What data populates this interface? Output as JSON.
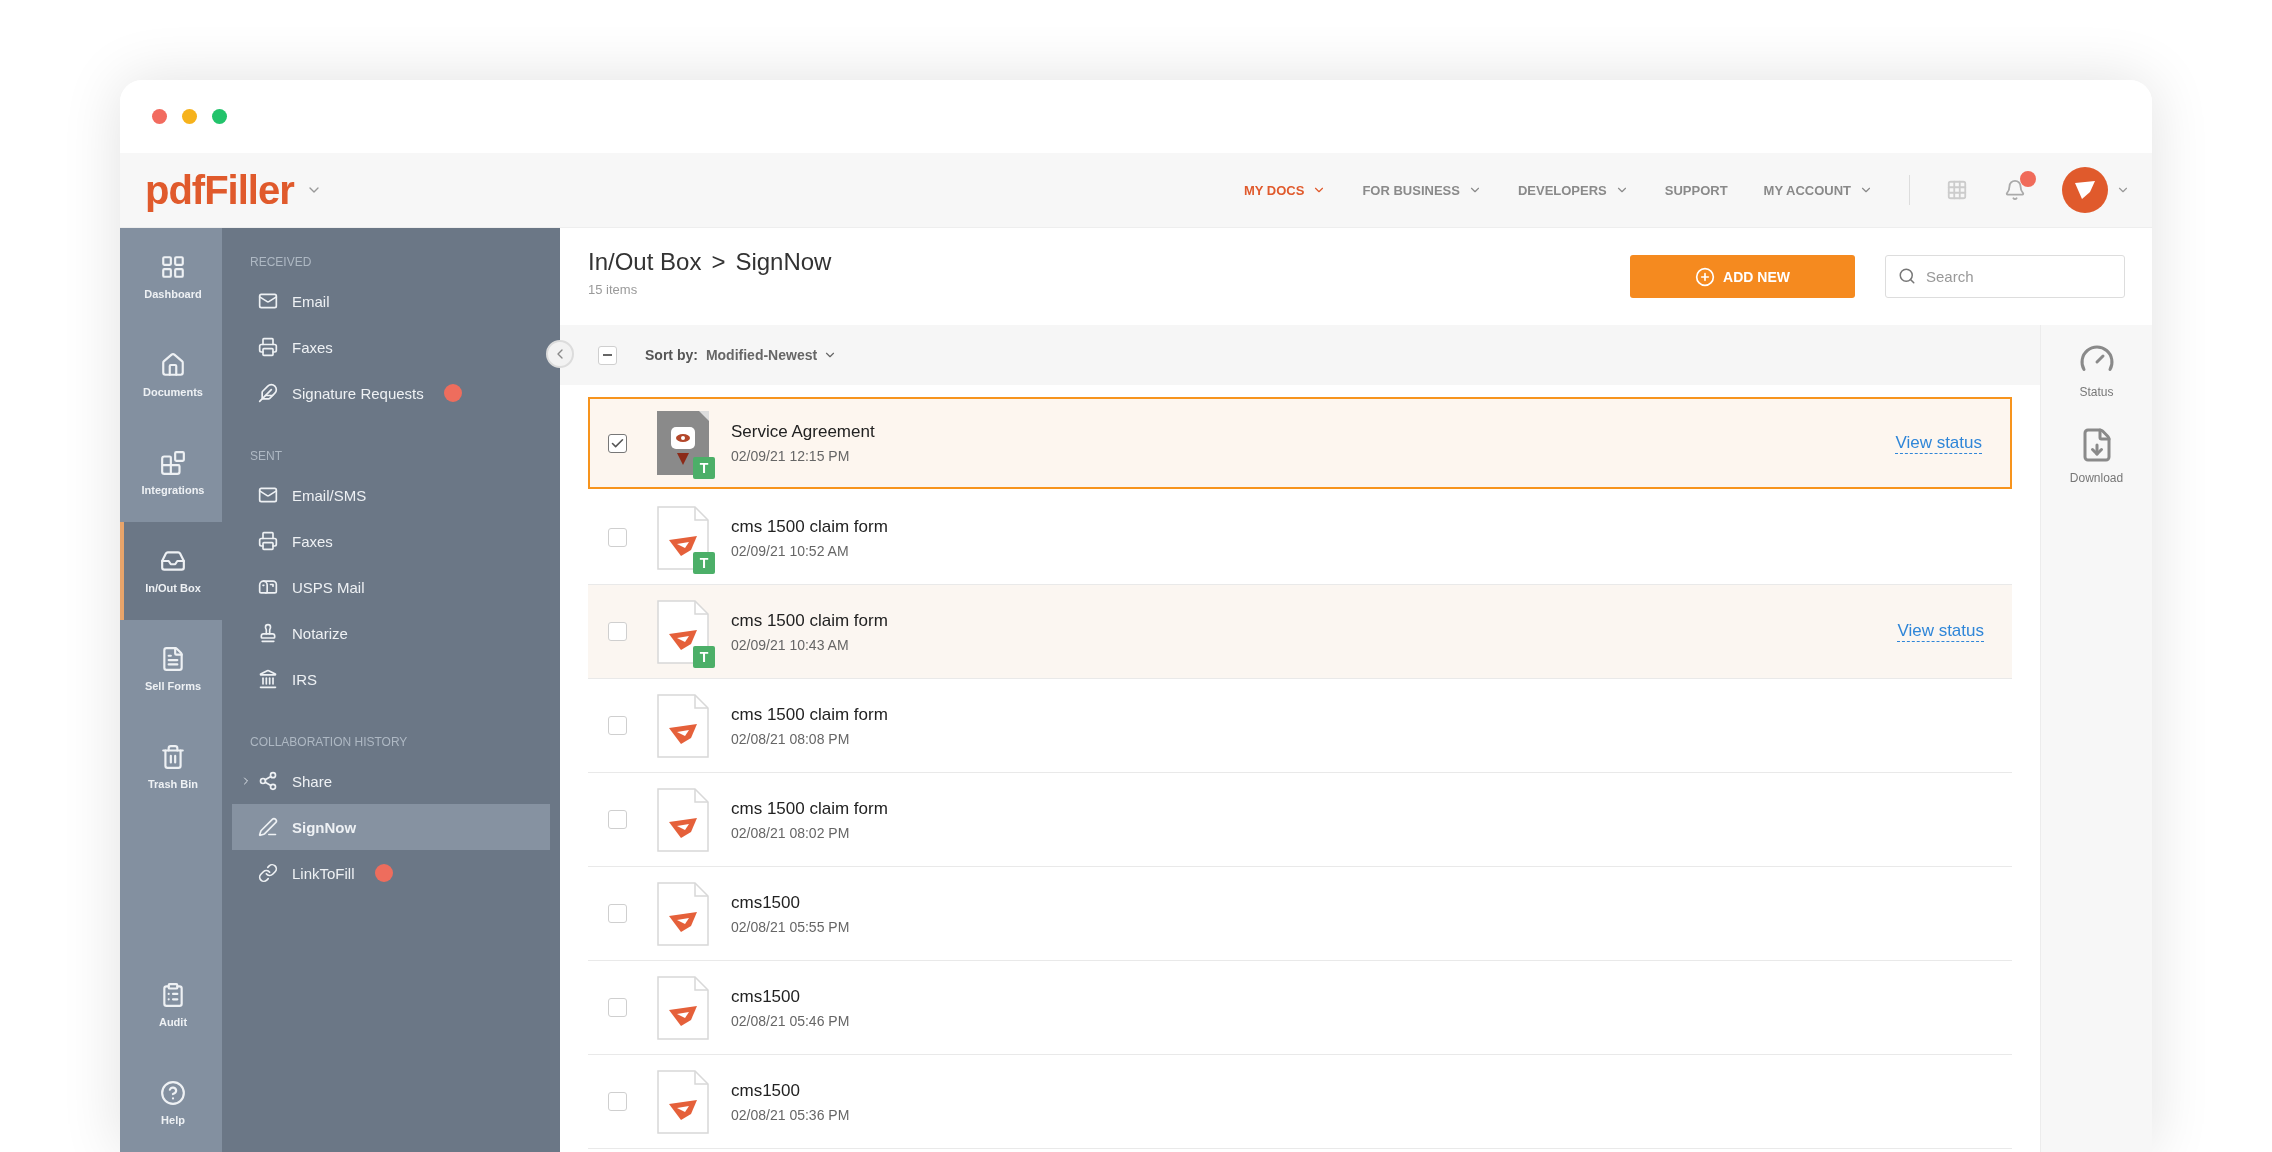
{
  "header": {
    "logo": "pdfFiller",
    "nav": [
      {
        "label": "MY DOCS",
        "selected": true,
        "has_menu": true
      },
      {
        "label": "FOR BUSINESS",
        "selected": false,
        "has_menu": true
      },
      {
        "label": "DEVELOPERS",
        "selected": false,
        "has_menu": true
      },
      {
        "label": "SUPPORT",
        "selected": false,
        "has_menu": false
      },
      {
        "label": "MY ACCOUNT",
        "selected": false,
        "has_menu": true
      }
    ]
  },
  "rail": {
    "top": [
      {
        "label": "Dashboard",
        "selected": false
      },
      {
        "label": "Documents",
        "selected": false
      },
      {
        "label": "Integrations",
        "selected": false
      },
      {
        "label": "In/Out Box",
        "selected": true
      },
      {
        "label": "Sell Forms",
        "selected": false
      },
      {
        "label": "Trash Bin",
        "selected": false
      }
    ],
    "bottom": [
      {
        "label": "Audit",
        "selected": false
      },
      {
        "label": "Help",
        "selected": false
      }
    ]
  },
  "sidebar": {
    "sections": [
      {
        "title": "RECEIVED",
        "items": [
          {
            "label": "Email",
            "selected": false,
            "has_badge": false,
            "expandable": false
          },
          {
            "label": "Faxes",
            "selected": false,
            "has_badge": false,
            "expandable": false
          },
          {
            "label": "Signature Requests",
            "selected": false,
            "has_badge": true,
            "expandable": false
          }
        ]
      },
      {
        "title": "SENT",
        "items": [
          {
            "label": "Email/SMS",
            "selected": false,
            "has_badge": false,
            "expandable": false
          },
          {
            "label": "Faxes",
            "selected": false,
            "has_badge": false,
            "expandable": false
          },
          {
            "label": "USPS Mail",
            "selected": false,
            "has_badge": false,
            "expandable": false
          },
          {
            "label": "Notarize",
            "selected": false,
            "has_badge": false,
            "expandable": false
          },
          {
            "label": "IRS",
            "selected": false,
            "has_badge": false,
            "expandable": false
          }
        ]
      },
      {
        "title": "COLLABORATION HISTORY",
        "items": [
          {
            "label": "Share",
            "selected": false,
            "has_badge": false,
            "expandable": true
          },
          {
            "label": "SignNow",
            "selected": true,
            "has_badge": false,
            "expandable": false
          },
          {
            "label": "LinkToFill",
            "selected": false,
            "has_badge": true,
            "expandable": false
          }
        ]
      }
    ]
  },
  "main": {
    "breadcrumb": [
      "In/Out Box",
      "SignNow"
    ],
    "breadcrumb_separator": ">",
    "count": "15 items",
    "add_button": "ADD NEW",
    "search": {
      "placeholder": "Search"
    },
    "bulk_select": {
      "partial": true
    },
    "sort": {
      "label": "Sort by:",
      "value": "Modified-Newest"
    },
    "rows": [
      {
        "name": "Service Agreement",
        "date": "02/09/21 12:15 PM",
        "selected": true,
        "highlighted": true,
        "kind": "preview",
        "tag": "T",
        "action": "View status"
      },
      {
        "name": "cms 1500 claim form",
        "date": "02/09/21 10:52 AM",
        "selected": false,
        "highlighted": false,
        "kind": "pdf",
        "tag": "T"
      },
      {
        "name": "cms 1500 claim form",
        "date": "02/09/21 10:43 AM",
        "selected": false,
        "highlighted": true,
        "kind": "pdf",
        "tag": "T",
        "action": "View status"
      },
      {
        "name": "cms 1500 claim form",
        "date": "02/08/21 08:08 PM",
        "selected": false,
        "highlighted": false,
        "kind": "pdf"
      },
      {
        "name": "cms 1500 claim form",
        "date": "02/08/21 08:02 PM",
        "selected": false,
        "highlighted": false,
        "kind": "pdf"
      },
      {
        "name": "cms1500",
        "date": "02/08/21 05:55 PM",
        "selected": false,
        "highlighted": false,
        "kind": "pdf"
      },
      {
        "name": "cms1500",
        "date": "02/08/21 05:46 PM",
        "selected": false,
        "highlighted": false,
        "kind": "pdf"
      },
      {
        "name": "cms1500",
        "date": "02/08/21 05:36 PM",
        "selected": false,
        "highlighted": false,
        "kind": "pdf"
      }
    ],
    "side_actions": [
      {
        "label": "Status"
      },
      {
        "label": "Download"
      }
    ]
  }
}
